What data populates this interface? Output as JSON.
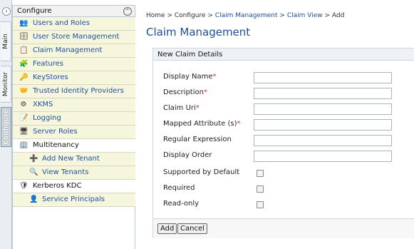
{
  "sidetabs": {
    "collapse_glyph": "‹",
    "main": "Main",
    "monitor": "Monitor",
    "configure": "Configure"
  },
  "menu": {
    "title": "Configure",
    "collapse_glyph": "⌃",
    "items": [
      {
        "label": "Users and Roles",
        "icon": "users-icon",
        "glyph": "👥"
      },
      {
        "label": "User Store Management",
        "icon": "user-store-icon",
        "glyph": "🗄"
      },
      {
        "label": "Claim Management",
        "icon": "claim-icon",
        "glyph": "📋"
      },
      {
        "label": "Features",
        "icon": "features-icon",
        "glyph": "🧩"
      },
      {
        "label": "KeyStores",
        "icon": "key-icon",
        "glyph": "🔑"
      },
      {
        "label": "Trusted Identity Providers",
        "icon": "handshake-icon",
        "glyph": "🤝"
      },
      {
        "label": "XKMS",
        "icon": "xkms-icon",
        "glyph": "⚙"
      },
      {
        "label": "Logging",
        "icon": "logging-icon",
        "glyph": "📝"
      },
      {
        "label": "Server Roles",
        "icon": "server-roles-icon",
        "glyph": "🖥"
      },
      {
        "label": "Multitenancy",
        "icon": "multitenancy-icon",
        "glyph": "🏢"
      },
      {
        "label": "Add New Tenant",
        "icon": "add-tenant-icon",
        "glyph": "➕"
      },
      {
        "label": "View Tenants",
        "icon": "view-tenants-icon",
        "glyph": "🔍"
      },
      {
        "label": "Kerberos KDC",
        "icon": "kerberos-icon",
        "glyph": "🛡"
      },
      {
        "label": "Service Principals",
        "icon": "service-principal-icon",
        "glyph": "👤"
      }
    ]
  },
  "breadcrumb": {
    "home": "Home",
    "configure": "Configure",
    "claim_management": "Claim Management",
    "claim_view": "Claim View",
    "current": "Add",
    "separator": ">"
  },
  "page_title": "Claim Management",
  "form": {
    "section_title": "New Claim Details",
    "required_mark": "*",
    "fields": {
      "display_name": {
        "label": "Display Name",
        "value": ""
      },
      "description": {
        "label": "Description",
        "value": ""
      },
      "claim_uri": {
        "label": "Claim Uri",
        "value": ""
      },
      "mapped_attribute": {
        "label": "Mapped Attribute (s)",
        "value": ""
      },
      "regular_expression": {
        "label": "Regular Expression",
        "value": ""
      },
      "display_order": {
        "label": "Display Order",
        "value": ""
      }
    },
    "checkboxes": {
      "supported_by_default": {
        "label": "Supported by Default",
        "checked": false
      },
      "required": {
        "label": "Required",
        "checked": false
      },
      "read_only": {
        "label": "Read-only",
        "checked": false
      }
    },
    "add_label": "Add",
    "cancel_label": "Cancel"
  }
}
